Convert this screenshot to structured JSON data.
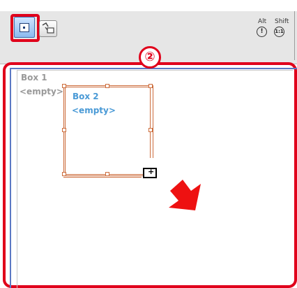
{
  "toolbar": {
    "tools": [
      {
        "name": "select-tool",
        "icon": "select-box-icon",
        "selected": true
      },
      {
        "name": "link-tool",
        "icon": "link-icon",
        "selected": false
      }
    ],
    "modifiers": [
      {
        "label": "Alt",
        "icon_text": "!"
      },
      {
        "label": "Shift",
        "icon_text": "1:1"
      }
    ]
  },
  "annotation": {
    "step": "②",
    "accent_color": "#e0001b"
  },
  "canvas": {
    "boxes": [
      {
        "title": "Box 1",
        "content": "<empty>",
        "color": "#999999"
      },
      {
        "title": "Box 2",
        "content": "<empty>",
        "color": "#4a9ad6"
      }
    ]
  }
}
